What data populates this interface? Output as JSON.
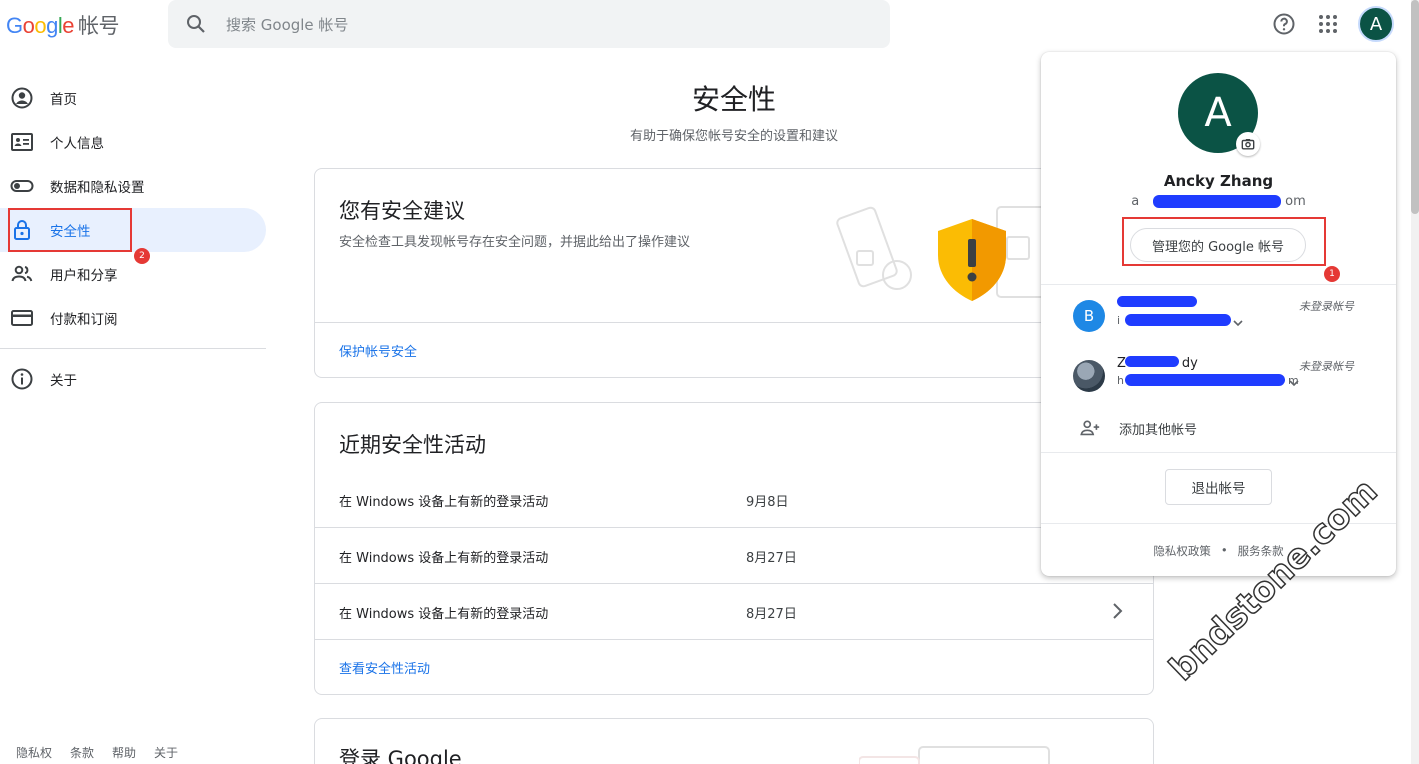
{
  "header": {
    "logo_text": "Google",
    "logo_suffix": "帐号",
    "search_placeholder": "搜索 Google 帐号",
    "avatar_letter": "A"
  },
  "sidebar": {
    "items": [
      {
        "label": "首页",
        "icon": "account-circle-icon"
      },
      {
        "label": "个人信息",
        "icon": "id-card-icon"
      },
      {
        "label": "数据和隐私设置",
        "icon": "toggle-icon"
      },
      {
        "label": "安全性",
        "icon": "lock-icon"
      },
      {
        "label": "用户和分享",
        "icon": "people-icon"
      },
      {
        "label": "付款和订阅",
        "icon": "credit-card-icon"
      },
      {
        "label": "关于",
        "icon": "info-icon"
      }
    ],
    "active_index": 3,
    "badge_number": "2",
    "footer": [
      "隐私权",
      "条款",
      "帮助",
      "关于"
    ]
  },
  "main": {
    "title": "安全性",
    "subtitle": "有助于确保您帐号安全的设置和建议",
    "recommend_card": {
      "title": "您有安全建议",
      "desc": "安全检查工具发现帐号存在安全问题，并据此给出了操作建议",
      "link": "保护帐号安全"
    },
    "activity_card": {
      "title": "近期安全性活动",
      "rows": [
        {
          "desc": "在 Windows 设备上有新的登录活动",
          "date": "9月8日"
        },
        {
          "desc": "在 Windows 设备上有新的登录活动",
          "date": "8月27日"
        },
        {
          "desc": "在 Windows 设备上有新的登录活动",
          "date": "8月27日"
        }
      ],
      "link": "查看安全性活动"
    },
    "signin_card": {
      "title": "登录 Google"
    }
  },
  "popup": {
    "avatar_letter": "A",
    "name": "Ancky Zhang",
    "email_prefix": "a",
    "email_suffix": "om",
    "manage_button": "管理您的 Google 帐号",
    "badge_number": "1",
    "accounts": [
      {
        "avatar_letter": "B",
        "avatar_color": "#1e88e5",
        "name_suffix": "",
        "mail_prefix": "i",
        "status": "未登录帐号"
      },
      {
        "avatar_letter": "",
        "avatar_color": "#5d6d7e",
        "name_prefix": "Z",
        "name_suffix": "dy",
        "mail_prefix": "h",
        "mail_suffix": "m",
        "status": "未登录帐号"
      }
    ],
    "add_account": "添加其他帐号",
    "sign_out": "退出帐号",
    "privacy": "隐私权政策",
    "dot": "•",
    "terms": "服务条款"
  },
  "watermark": "bndstone.com",
  "colors": {
    "accent": "#1a73e8",
    "highlight_red": "#e53935",
    "avatar_green": "#0b5345",
    "redaction_blue": "#1f3cff"
  }
}
